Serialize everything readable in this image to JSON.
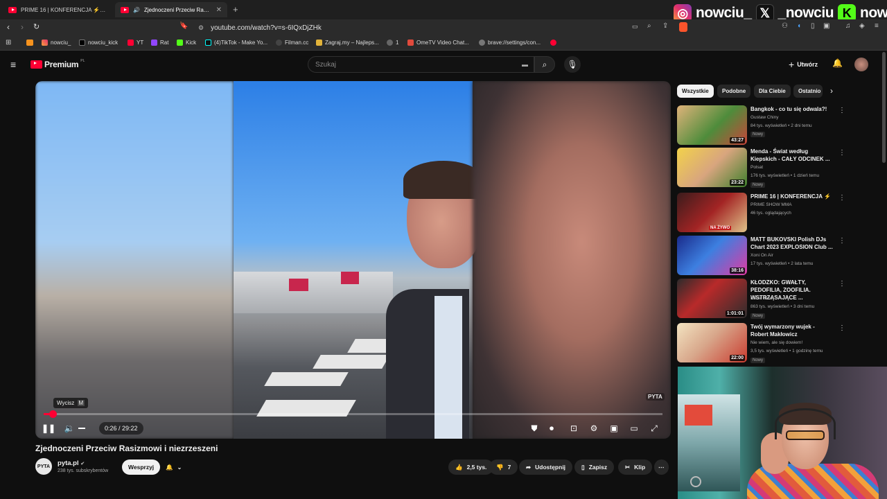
{
  "tabs": [
    {
      "label": "PRIME 16 | KONFERENCJA ⚡ - YouTube",
      "active": false
    },
    {
      "label": "Zjednoczeni Przeciw Rasizmowi",
      "active": true
    }
  ],
  "new_tab": "+",
  "overlay_socials": {
    "instagram": "nowciu_",
    "x": "_nowciu",
    "kick": "nowciu"
  },
  "address": {
    "url": "youtube.com/watch?v=s-6IQxDjZHk"
  },
  "bookmarks": [
    "nowciu_",
    "nowciu_kick",
    "YT",
    "Rat",
    "Kick",
    "(4)TikTok - Make Yo...",
    "Filman.cc",
    "Zagraj.my – Najleps...",
    "1",
    "OmeTV Video Chat...",
    "brave://settings/con..."
  ],
  "yt_header": {
    "logo_text": "Premium",
    "region": "PL",
    "search_placeholder": "Szukaj",
    "create_label": "Utwórz"
  },
  "player": {
    "current_time": "0:26",
    "duration": "29:22",
    "time_display": "0:26 / 29:22",
    "progress_fraction": 0.015,
    "tooltip": "Wycisz",
    "tooltip_key": "M",
    "watermark": "PYTA"
  },
  "video": {
    "title": "Zjednoczeni Przeciw Rasizmowi i niezrzeszeni",
    "channel": "pyta.pl",
    "subscribers": "238 tys. subskrybentów",
    "support_label": "Wesprzyj",
    "likes": "2,5 tys.",
    "dislikes": "7",
    "share_label": "Udostępnij",
    "save_label": "Zapisz",
    "clip_label": "Klip"
  },
  "chips": [
    "Wszystkie",
    "Podobne",
    "Dla Ciebie",
    "Ostatnio"
  ],
  "recommendations": [
    {
      "title": "Bangkok - co tu się odwala?!",
      "channel": "Gustaw Chiny",
      "meta": "84 tys. wyświetleń • 2 dni temu",
      "duration": "43:27",
      "badge": "Nowy"
    },
    {
      "title": "Menda - Świat według Kiepskich - CAŁY ODCINEK ...",
      "channel": "Polsat",
      "meta": "176 tys. wyświetleń • 1 dzień temu",
      "duration": "23:22",
      "badge": "Nowy"
    },
    {
      "title": "PRIME 16 | KONFERENCJA ⚡",
      "channel": "PRIME SHOW MMA",
      "meta": "46 tys. oglądających",
      "duration": "",
      "badge": ""
    },
    {
      "title": "MATT BUKOVSKI Polish DJs Chart 2023 EXPLOSION Club ...",
      "channel": "Xoni On Air",
      "meta": "17 tys. wyświetleń • 2 lata temu",
      "duration": "38:16",
      "badge": ""
    },
    {
      "title": "KŁODZKO: GWAŁTY, PEDOFILIA, ZOOFILIA. WSTRZĄSAJĄCE ...",
      "channel": "Kanał Zero",
      "meta": "863 tys. wyświetleń • 3 dni temu",
      "duration": "1:01:01",
      "badge": "Nowy"
    },
    {
      "title": "Twój wymarzony wujek - Robert Makłowicz",
      "channel": "Nie wiem, ale się dowiem!",
      "meta": "3,5 tys. wyświetleń • 1 godzinę temu",
      "duration": "22:00",
      "badge": "Nowy"
    }
  ],
  "colors": {
    "accent": "#ff0033",
    "background": "#0f0f0f",
    "kick": "#53fc18"
  }
}
